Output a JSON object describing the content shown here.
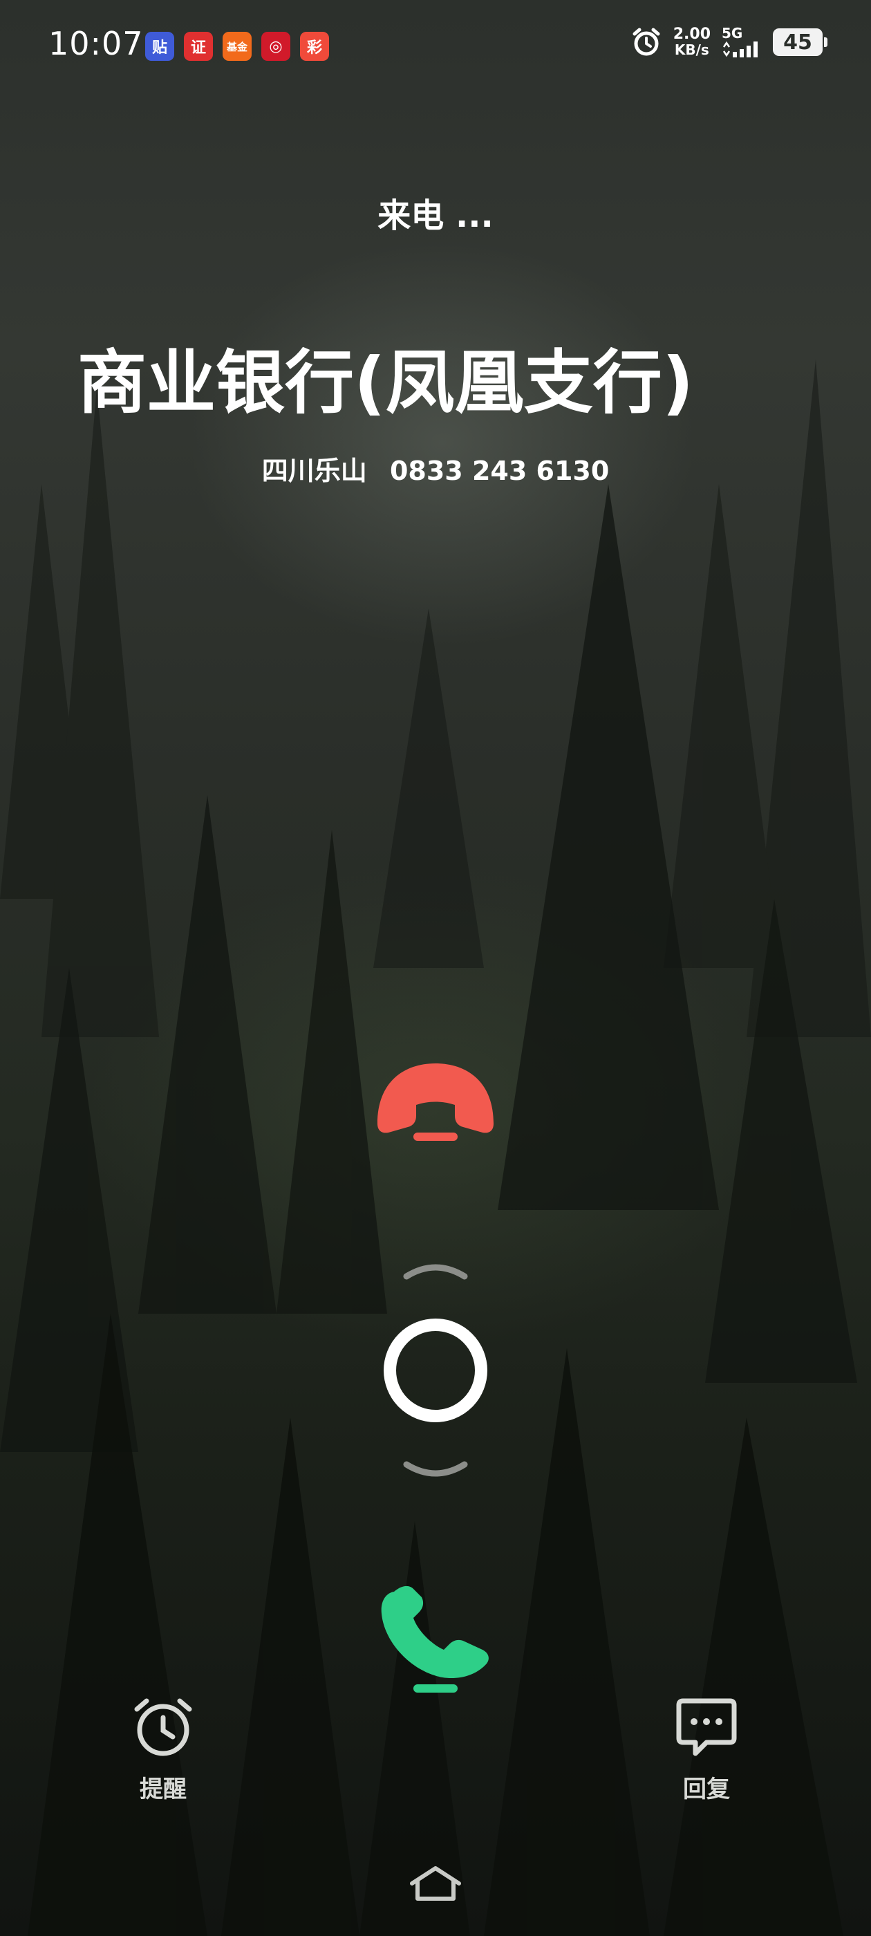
{
  "status_bar": {
    "time": "10:07",
    "notification_icons": [
      {
        "name": "tieba-app-icon",
        "glyph": "贴",
        "color": "#3f5bd8"
      },
      {
        "name": "securities-app-icon",
        "glyph": "证",
        "color": "#e03030"
      },
      {
        "name": "fund-app-icon",
        "glyph": "基金",
        "color": "#f26a1b"
      },
      {
        "name": "boc-app-icon",
        "glyph": "◎",
        "color": "#d11a2a"
      },
      {
        "name": "lottery-app-icon",
        "glyph": "彩",
        "color": "#f04a3a"
      }
    ],
    "net_speed": "2.00",
    "net_unit": "KB/s",
    "network": "5G",
    "battery": "45"
  },
  "call": {
    "status": "来电 ...",
    "caller_name": "商业银行(凤凰支行)",
    "location": "四川乐山",
    "number": "0833 243 6130"
  },
  "colors": {
    "decline": "#f25a4f",
    "answer": "#2ecf88"
  },
  "actions": {
    "reminder_label": "提醒",
    "reply_label": "回复"
  }
}
